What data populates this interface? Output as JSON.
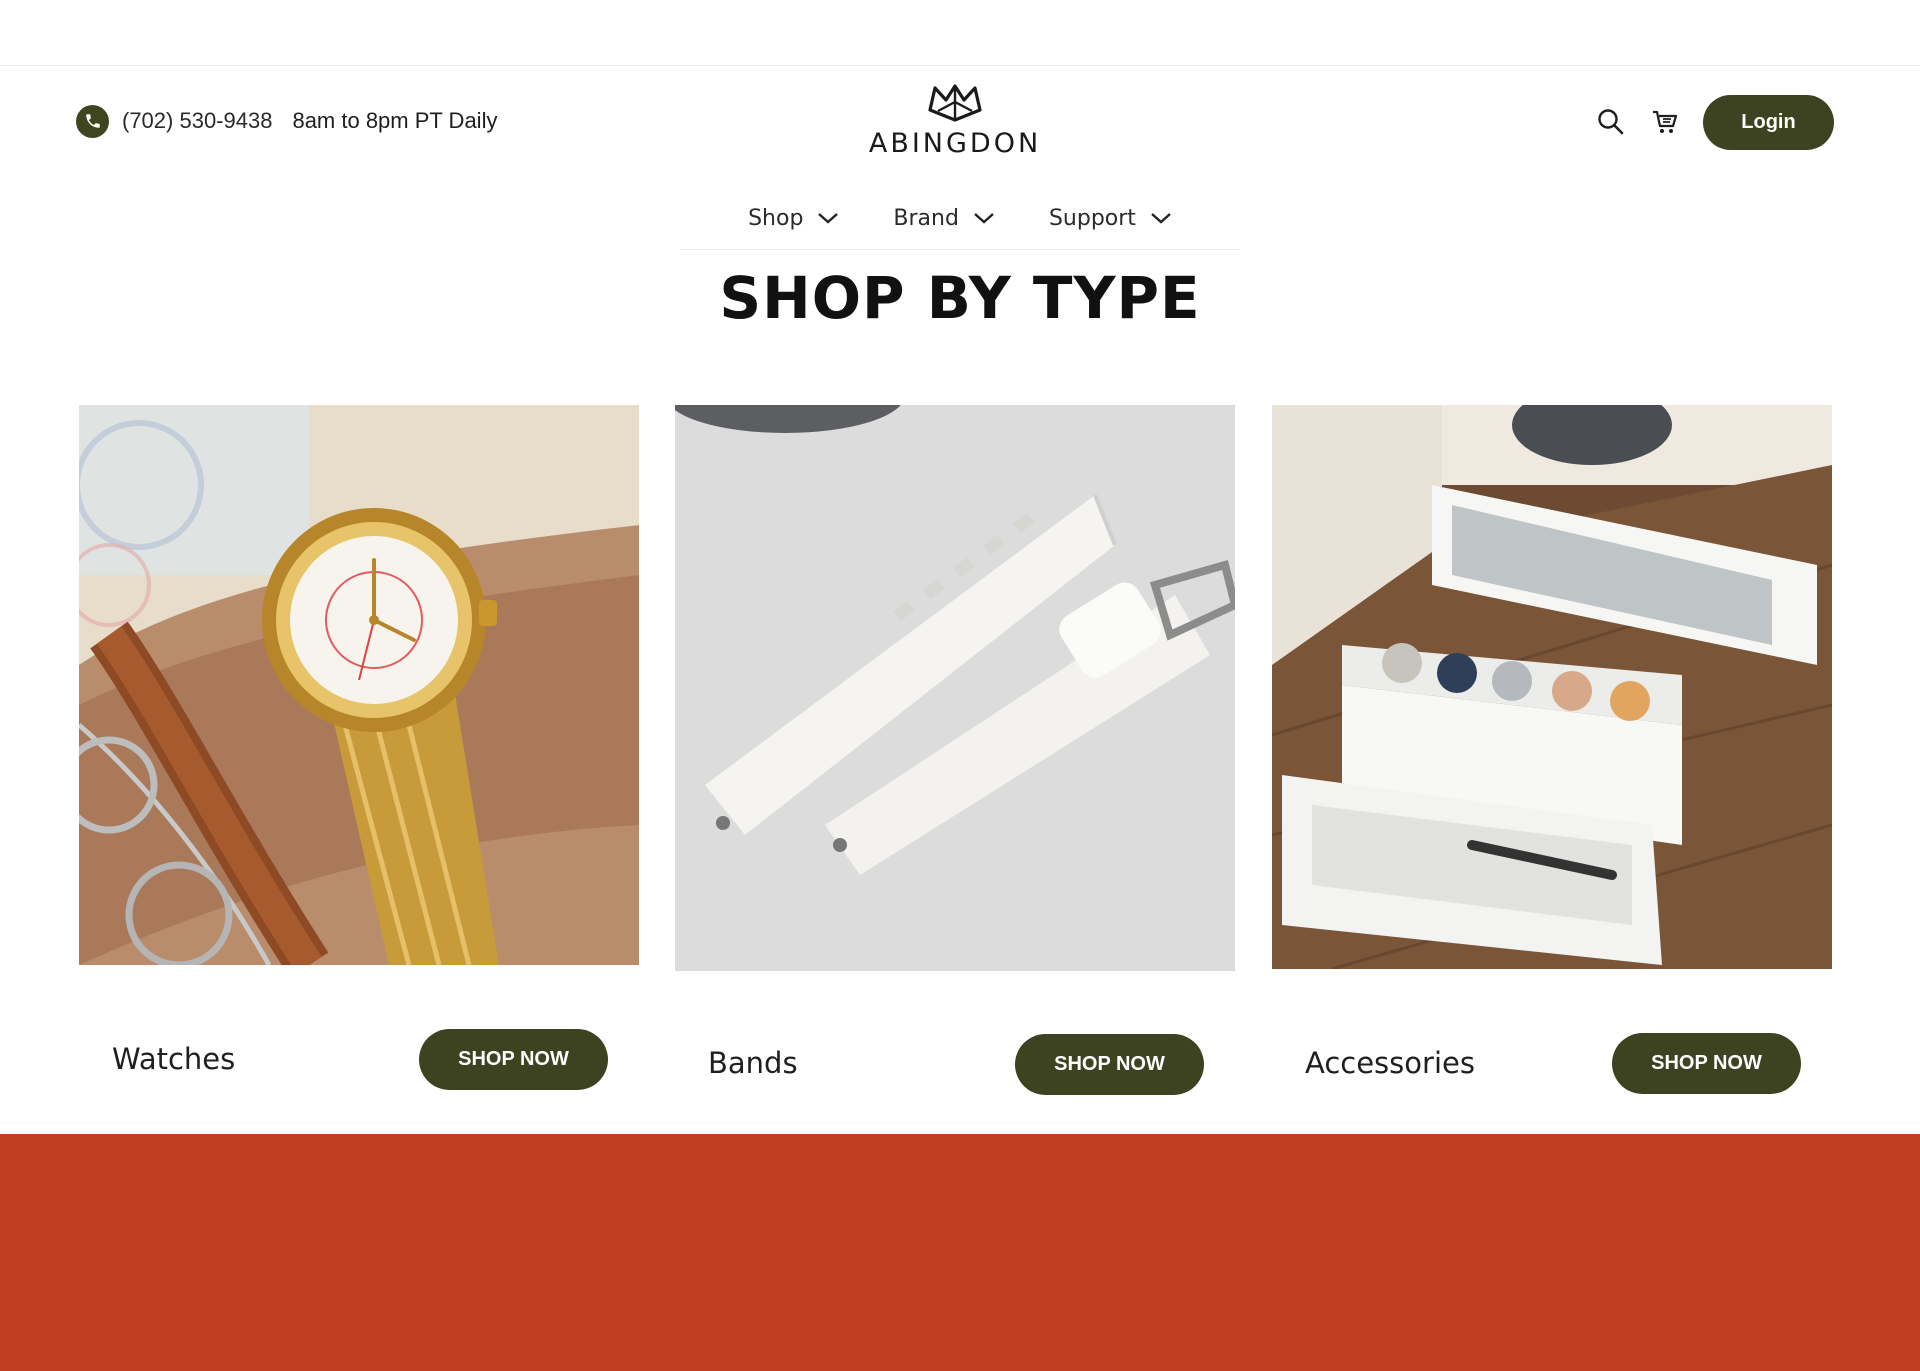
{
  "header": {
    "phone": "(702) 530-9438",
    "hours": "8am to 8pm PT Daily",
    "brand": "ABINGDON",
    "login_label": "Login"
  },
  "nav": {
    "items": [
      {
        "label": "Shop"
      },
      {
        "label": "Brand"
      },
      {
        "label": "Support"
      }
    ]
  },
  "section": {
    "title": "SHOP BY TYPE"
  },
  "cards": [
    {
      "label": "Watches",
      "button": "SHOP NOW"
    },
    {
      "label": "Bands",
      "button": "SHOP NOW"
    },
    {
      "label": "Accessories",
      "button": "SHOP NOW"
    }
  ],
  "colors": {
    "brand_green": "#3d4320",
    "footer_red": "#c23d22"
  },
  "icons": [
    "phone-icon",
    "search-icon",
    "cart-icon",
    "chevron-down-icon"
  ]
}
